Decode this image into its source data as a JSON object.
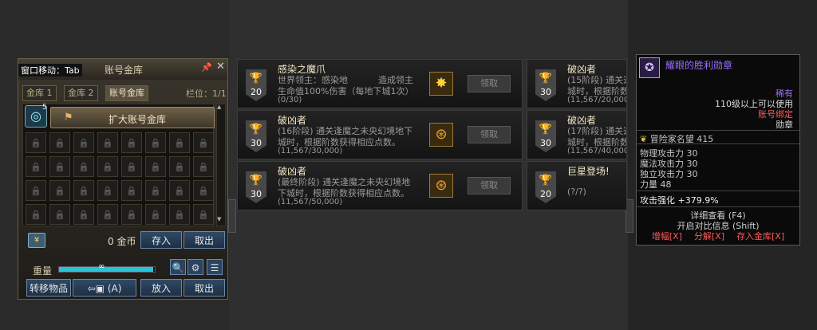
{
  "warehouse": {
    "move_hint": "窗口移动：Tab",
    "title": "账号金库",
    "pin_icon": "pin-icon",
    "close_icon": "close-icon",
    "tabs": [
      "金库 1",
      "金库 2",
      "账号金库"
    ],
    "slot_label": "栏位：1/1",
    "expand_button": "扩大账号金库",
    "badge_number": "5",
    "gold_value": "0",
    "gold_unit": "金币",
    "deposit_button": "存入",
    "withdraw_button": "取出",
    "weight_label": "重量",
    "weight_value": "∞",
    "weight_fill": 1.0,
    "transfer_button": "转移物品",
    "transfer_shortcut": "(A)",
    "put_button": "放入",
    "take_button": "取出"
  },
  "achievements": [
    {
      "points": "20",
      "title": "感染之魔爪",
      "line1": "世界领主：感染地",
      "line1b": "造成领主",
      "line2": "生命值100%伤害（每地下城1次）",
      "progress": "(0/30)",
      "claim": "领取",
      "reward_color": "#ffd23a",
      "reward_icon": "star-burst-icon"
    },
    {
      "points": "30",
      "title": "破凶者",
      "line1": "(16阶段) 通关逢魔之未央幻境地下",
      "line2": "城时，根据阶数获得相应点数。",
      "progress": "(11,567/30,000)",
      "claim": "领取",
      "reward_color": "#e8a030",
      "reward_icon": "emblem-icon"
    },
    {
      "points": "30",
      "title": "破凶者",
      "line1": "(最终阶段) 通关逢魔之未央幻境地",
      "line2": "下城时，根据阶数获得相应点数。",
      "progress": "(11,567/50,000)",
      "claim": "领取",
      "reward_color": "#e8a030",
      "reward_icon": "emblem-icon"
    },
    {
      "points": "30",
      "title": "破凶者",
      "line1": "(15阶段) 通关逢",
      "line2": "城时，根据阶数",
      "progress": "(11,567/20,000)"
    },
    {
      "points": "30",
      "title": "破凶者",
      "line1": "(17阶段) 通关逢",
      "line2": "城时，根据阶数",
      "progress": "(11,567/40,000)"
    },
    {
      "points": "20",
      "title": "巨星登场!",
      "line1": "(?/?)",
      "line2": "",
      "progress": ""
    }
  ],
  "tooltip": {
    "name": "耀眼的胜利勋章",
    "rarity": "稀有",
    "level_req": "110级以上可以使用",
    "bind": "账号绑定",
    "type": "勋章",
    "fame_label": "冒险家名望",
    "fame_value": "415",
    "stats": [
      "物理攻击力 30",
      "魔法攻击力 30",
      "独立攻击力 30",
      "力量 48"
    ],
    "enhance": "攻击强化 +379.9%",
    "detail": "详细查看 (F4)",
    "compare": "开启对比信息 (Shift)",
    "actions": [
      "增幅[X]",
      "分解[X]",
      "存入金库[X]"
    ],
    "rarity_color": "#9b6fff",
    "bind_color": "#ff5a5a"
  }
}
